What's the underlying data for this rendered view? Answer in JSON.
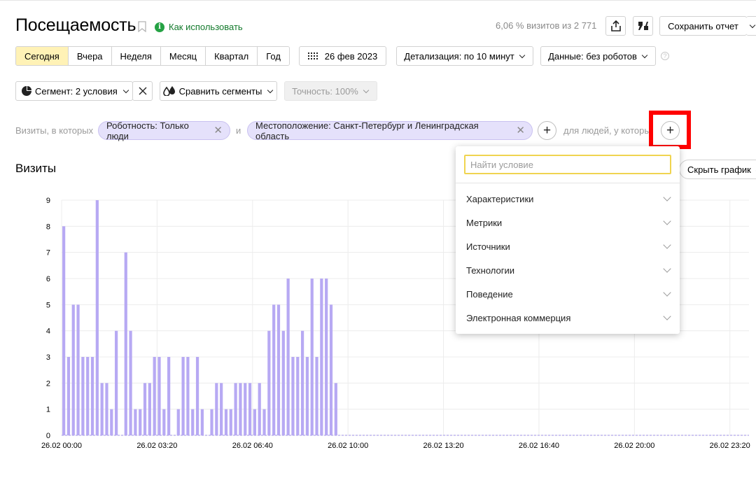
{
  "header": {
    "title": "Посещаемость",
    "howto": "Как использовать",
    "visits_info": "6,06 % визитов из 2 771",
    "save_label": "Сохранить отчет"
  },
  "periods": [
    {
      "label": "Сегодня",
      "active": true
    },
    {
      "label": "Вчера",
      "active": false
    },
    {
      "label": "Неделя",
      "active": false
    },
    {
      "label": "Месяц",
      "active": false
    },
    {
      "label": "Квартал",
      "active": false
    },
    {
      "label": "Год",
      "active": false
    }
  ],
  "toolbar": {
    "date": "26 фев 2023",
    "detail": "Детализация: по 10 минут",
    "data": "Данные: без роботов",
    "help": "?",
    "segment": "Сегмент: 2 условия",
    "compare": "Сравнить сегменты",
    "accuracy": "Точность: 100%"
  },
  "conditions": {
    "prefix": "Визиты, в которых",
    "chip1": "Роботность: Только люди",
    "and": "и",
    "chip2": "Местоположение: Санкт-Петербург и Ленинградская область",
    "people": "для людей, у которых"
  },
  "chart_section": {
    "title": "Визиты",
    "hide_label": "Скрыть график"
  },
  "dropdown": {
    "placeholder": "Найти условие",
    "items": [
      "Характеристики",
      "Метрики",
      "Источники",
      "Технологии",
      "Поведение",
      "Электронная коммерция"
    ]
  },
  "colors": {
    "bar": "#b7a9f3",
    "accent_green": "#1a7f37",
    "active_tab": "#fff2b6",
    "highlight": "#ff0000"
  },
  "chart_data": {
    "type": "bar",
    "xlabel": "",
    "ylabel": "",
    "ylim": [
      0,
      9
    ],
    "yticks": [
      "0",
      "1",
      "2",
      "3",
      "4",
      "5",
      "6",
      "7",
      "8",
      "9"
    ],
    "xticks": [
      "26.02 00:00",
      "26.02 03:20",
      "26.02 06:40",
      "26.02 10:00",
      "26.02 13:20",
      "26.02 16:40",
      "26.02 20:00",
      "26.02 23:20"
    ],
    "interval_minutes": 10,
    "values": [
      8,
      3,
      5,
      5,
      3,
      3,
      3,
      9,
      2,
      2,
      1,
      4,
      0,
      7,
      4,
      1,
      1,
      2,
      2,
      3,
      3,
      1,
      3,
      0,
      1,
      3,
      3,
      1,
      3,
      1,
      0,
      1,
      2,
      2,
      1,
      1,
      2,
      2,
      2,
      2,
      1,
      2,
      1,
      4,
      5,
      5,
      4,
      6,
      3,
      3,
      4,
      3,
      6,
      3,
      6,
      6,
      5,
      2,
      0,
      0,
      0,
      0,
      0,
      0,
      0,
      0,
      0,
      0,
      0,
      0,
      0,
      0,
      0,
      0,
      0,
      0,
      0,
      0,
      0,
      0,
      0,
      0,
      0,
      0,
      0,
      0,
      0,
      0,
      0,
      0,
      0,
      0,
      0,
      0,
      0,
      0,
      0,
      0,
      0,
      0,
      0,
      0,
      0,
      0,
      0,
      0,
      0,
      0,
      0,
      0,
      0,
      0,
      0,
      0,
      0,
      0,
      0,
      0,
      0,
      0,
      0,
      0,
      0,
      0,
      0,
      0,
      0,
      0,
      0,
      0,
      0,
      0,
      0,
      0,
      0,
      0,
      0,
      0,
      0,
      0,
      0,
      0,
      0,
      0
    ]
  }
}
